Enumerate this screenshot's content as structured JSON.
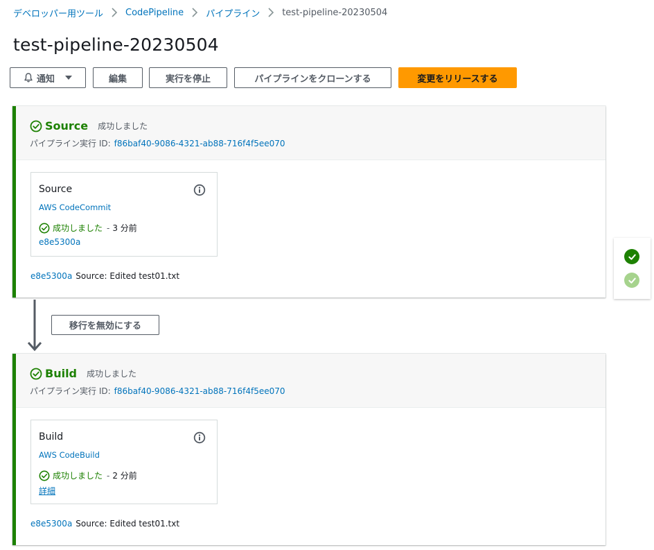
{
  "breadcrumb": {
    "items": [
      "デベロッパー用ツール",
      "CodePipeline",
      "パイプライン"
    ],
    "current": "test-pipeline-20230504"
  },
  "page": {
    "title": "test-pipeline-20230504"
  },
  "actions": {
    "notify": "通知",
    "edit": "編集",
    "stop": "実行を停止",
    "clone": "パイプラインをクローンする",
    "release": "変更をリリースする"
  },
  "stages": [
    {
      "name": "Source",
      "status": "成功しました",
      "exec_label": "パイプライン実行 ID:",
      "exec_id": "f86baf40-9086-4321-ab88-716f4f5ee070",
      "action": {
        "name": "Source",
        "provider": "AWS CodeCommit",
        "status": "成功しました",
        "sep": "-",
        "time": "3 分前",
        "link": "e8e5300a"
      },
      "commit": {
        "id": "e8e5300a",
        "message": "Source: Edited test01.txt"
      }
    },
    {
      "name": "Build",
      "status": "成功しました",
      "exec_label": "パイプライン実行 ID:",
      "exec_id": "f86baf40-9086-4321-ab88-716f4f5ee070",
      "action": {
        "name": "Build",
        "provider": "AWS CodeBuild",
        "status": "成功しました",
        "sep": "-",
        "time": "2 分前",
        "link": "詳細"
      },
      "commit": {
        "id": "e8e5300a",
        "message": "Source: Edited test01.txt"
      }
    }
  ],
  "transition": {
    "disable_label": "移行を無効にする"
  },
  "colors": {
    "success": "#1d8102",
    "link": "#0073bb",
    "primary": "#ff9900",
    "success_light": "#a6d38d"
  },
  "icons": {
    "stage_status": "check-circle-outline-icon",
    "info": "info-icon",
    "notify": "bell-icon",
    "dropdown": "caret-down-icon",
    "breadcrumb_separator": "chevron-right-icon",
    "transition": "arrow-down-icon",
    "side_status": [
      "check-circle-filled-icon",
      "check-circle-light-icon"
    ]
  }
}
